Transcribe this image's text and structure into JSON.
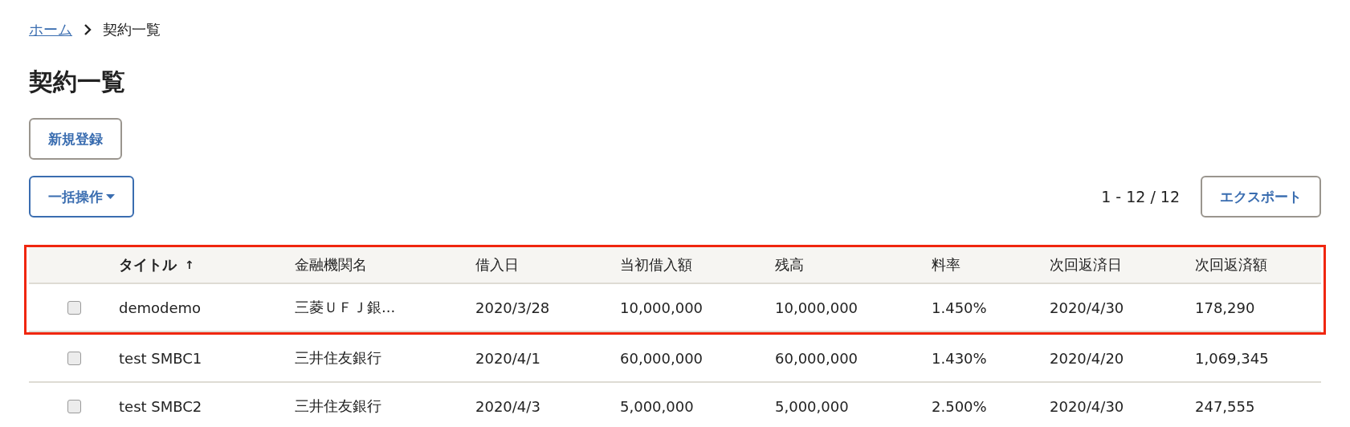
{
  "breadcrumb": [
    {
      "label": "ホーム",
      "kind": "link"
    },
    {
      "label": "契約一覧",
      "kind": "current"
    }
  ],
  "title": "契約一覧",
  "new_button": "新規登録",
  "bulk_button": "一括操作",
  "count": "1 - 12 / 12",
  "export_button": "エクスポート",
  "table": {
    "columns": [
      {
        "label": "タイトル",
        "sort": "↑",
        "bold": true
      },
      {
        "label": "金融機関名"
      },
      {
        "label": "借入日"
      },
      {
        "label": "当初借入額"
      },
      {
        "label": "残高"
      },
      {
        "label": "料率"
      },
      {
        "label": "次回返済日"
      },
      {
        "label": "次回返済額"
      }
    ],
    "rows": [
      {
        "checked": false,
        "highlighted": true,
        "cells": [
          "demodemo",
          "三菱ＵＦＪ銀...",
          "2020/3/28",
          "10,000,000",
          "10,000,000",
          "1.450%",
          "2020/4/30",
          "178,290"
        ]
      },
      {
        "checked": false,
        "highlighted": false,
        "cells": [
          "test SMBC1",
          "三井住友銀行",
          "2020/4/1",
          "60,000,000",
          "60,000,000",
          "1.430%",
          "2020/4/20",
          "1,069,345"
        ]
      },
      {
        "checked": false,
        "highlighted": false,
        "cells": [
          "test SMBC2",
          "三井住友銀行",
          "2020/4/3",
          "5,000,000",
          "5,000,000",
          "2.500%",
          "2020/4/30",
          "247,555"
        ]
      }
    ]
  }
}
